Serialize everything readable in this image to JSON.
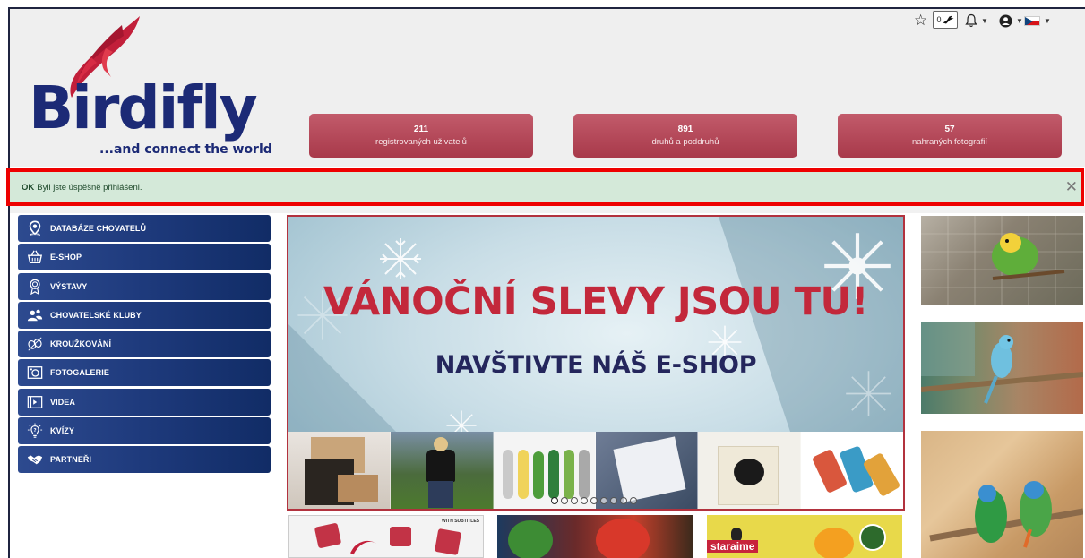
{
  "brand": {
    "name": "Birdifly",
    "tagline": "...and connect the world",
    "colors": {
      "navy": "#1c2a76",
      "red": "#c8233b",
      "stat": "#b3465a",
      "alert_bg": "#d4e9d9",
      "highlight": "#ee0000"
    }
  },
  "toolbar": {
    "favorites_icon": "star-icon",
    "favorites_count": "0",
    "notifications_icon": "bell-icon",
    "account_icon": "user-circle-icon",
    "language": "cs"
  },
  "stats": [
    {
      "value": "211",
      "label": "registrovaných uživatelů"
    },
    {
      "value": "891",
      "label": "druhů a poddruhů"
    },
    {
      "value": "57",
      "label": "nahraných fotografií"
    }
  ],
  "alert": {
    "status": "OK",
    "message": "Byli jste úspěšně přihlášeni.",
    "close_icon": "close-icon"
  },
  "sidebar": {
    "items": [
      {
        "label": "DATABÁZE CHOVATELŮ",
        "icon": "location-pin-icon"
      },
      {
        "label": "E-SHOP",
        "icon": "shopping-basket-icon"
      },
      {
        "label": "VÝSTAVY",
        "icon": "award-rosette-icon"
      },
      {
        "label": "CHOVATELSKÉ KLUBY",
        "icon": "users-group-icon"
      },
      {
        "label": "KROUŽKOVÁNÍ",
        "icon": "rings-icon"
      },
      {
        "label": "FOTOGALERIE",
        "icon": "camera-icon"
      },
      {
        "label": "VIDEA",
        "icon": "film-icon"
      },
      {
        "label": "KVÍZY",
        "icon": "lightbulb-question-icon"
      },
      {
        "label": "PARTNEŘI",
        "icon": "handshake-icon"
      }
    ]
  },
  "banner": {
    "title": "VÁNOČNÍ SLEVY JSOU TU!",
    "subtitle": "NAVŠTIVTE NÁŠ E-SHOP",
    "slide_count": 9,
    "active_slide": 1
  },
  "tiles": [
    {
      "label": "WITH SUBTITLES"
    },
    {
      "label": ""
    },
    {
      "label": "staraime"
    }
  ]
}
